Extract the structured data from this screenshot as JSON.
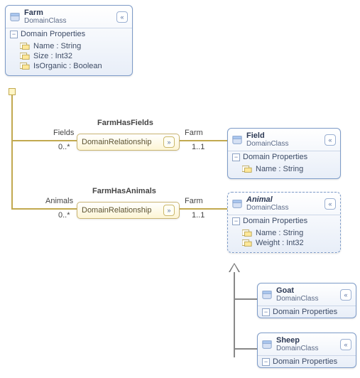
{
  "subLabel": "DomainClass",
  "sectionLabel": "Domain Properties",
  "relSub": "DomainRelationship",
  "farm": {
    "name": "Farm",
    "props": [
      {
        "label": "Name : String"
      },
      {
        "label": "Size : Int32"
      },
      {
        "label": "IsOrganic : Boolean"
      }
    ]
  },
  "field": {
    "name": "Field",
    "props": [
      {
        "label": "Name : String"
      }
    ]
  },
  "animal": {
    "name": "Animal",
    "props": [
      {
        "label": "Name : String"
      },
      {
        "label": "Weight : Int32"
      }
    ]
  },
  "goat": {
    "name": "Goat"
  },
  "sheep": {
    "name": "Sheep"
  },
  "rel1": {
    "title": "FarmHasFields",
    "leftRole": "Fields",
    "leftMult": "0..*",
    "rightRole": "Farm",
    "rightMult": "1..1"
  },
  "rel2": {
    "title": "FarmHasAnimals",
    "leftRole": "Animals",
    "leftMult": "0..*",
    "rightRole": "Farm",
    "rightMult": "1..1"
  },
  "glyph": {
    "collapse": "«",
    "expand": "»",
    "minus": "−"
  }
}
